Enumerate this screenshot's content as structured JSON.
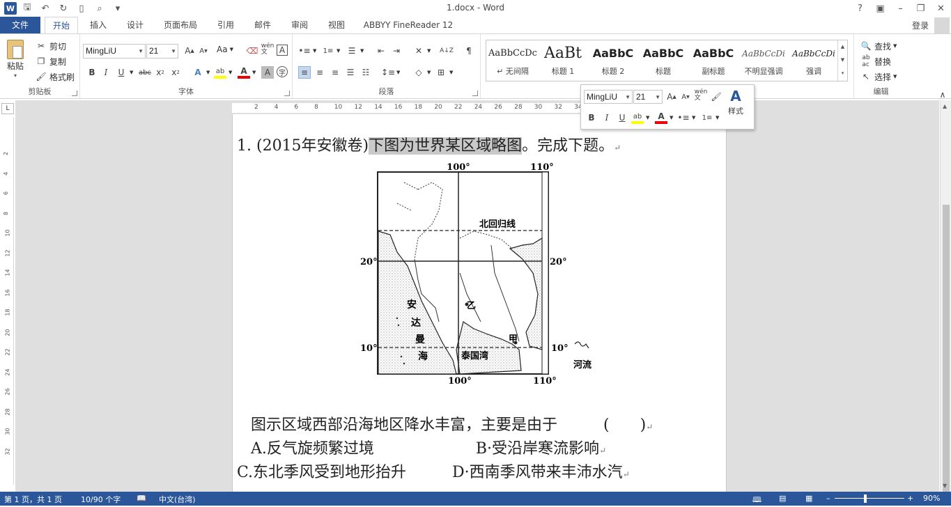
{
  "window": {
    "title": "1.docx - Word",
    "help": "?",
    "login": "登录"
  },
  "tabs": [
    {
      "id": "file",
      "label": "文件"
    },
    {
      "id": "home",
      "label": "开始"
    },
    {
      "id": "insert",
      "label": "插入"
    },
    {
      "id": "design",
      "label": "设计"
    },
    {
      "id": "layout",
      "label": "页面布局"
    },
    {
      "id": "references",
      "label": "引用"
    },
    {
      "id": "mailings",
      "label": "邮件"
    },
    {
      "id": "review",
      "label": "审阅"
    },
    {
      "id": "view",
      "label": "视图"
    },
    {
      "id": "abbyy",
      "label": "ABBYY FineReader 12"
    }
  ],
  "ribbon": {
    "clipboard": {
      "label": "剪贴板",
      "paste": "粘贴",
      "cut": "剪切",
      "copy": "复制",
      "painter": "格式刷"
    },
    "font": {
      "label": "字体",
      "name": "MingLiU",
      "size": "21",
      "aa": "Aa",
      "wen": "wén\n文"
    },
    "paragraph": {
      "label": "段落"
    },
    "styles": {
      "items": [
        {
          "preview": "AaBbCcDc",
          "name": "↵ 无间隔"
        },
        {
          "preview": "AaBt",
          "name": "标题 1"
        },
        {
          "preview": "AaBbC",
          "name": "标题 2"
        },
        {
          "preview": "AaBbC",
          "name": "标题"
        },
        {
          "preview": "AaBbC",
          "name": "副标题"
        },
        {
          "preview": "AaBbCcDi",
          "name": "不明显强调"
        },
        {
          "preview": "AaBbCcDi",
          "name": "强调"
        }
      ]
    },
    "editing": {
      "label": "编辑",
      "find": "查找",
      "replace": "替换",
      "select": "选择"
    }
  },
  "mini_toolbar": {
    "font": "MingLiU",
    "size": "21",
    "styles_label": "样式"
  },
  "ruler": {
    "h_ticks": [
      "2",
      "4",
      "6",
      "8",
      "10",
      "12",
      "14",
      "16",
      "18",
      "20",
      "22",
      "24",
      "26",
      "28",
      "30",
      "32",
      "34"
    ],
    "v_ticks": [
      "2",
      "4",
      "6",
      "8",
      "10",
      "12",
      "14",
      "16",
      "18",
      "20",
      "22",
      "24",
      "26",
      "28",
      "30",
      "32"
    ]
  },
  "document": {
    "q_prefix": "1. (2015年安徽卷)",
    "q_highlight": "下图为世界某区域略图",
    "q_suffix": "。完成下题。",
    "question": "图示区域西部沿海地区降水丰富，主要是由于",
    "paren": "(　　)",
    "optA": "A.反气旋频繁过境",
    "optB": "B·受沿岸寒流影响",
    "optC": "C.东北季风受到地形抬升",
    "optD": "D·西南季风带来丰沛水汽",
    "return_mark": "↵"
  },
  "map": {
    "lon_top_left": "100°",
    "lon_top_right": "110°",
    "lon_bottom_left": "100°",
    "lon_bottom_right": "110°",
    "lat_20_left": "20°",
    "lat_20_right": "20°",
    "lat_10_left": "10°",
    "lat_10_right": "10°",
    "tropic": "北回归线",
    "andaman": [
      "安",
      "达",
      "曼",
      "海"
    ],
    "gulf": "泰国湾",
    "yi": "乙",
    "jia": "甲",
    "legend_river": "河流"
  },
  "status": {
    "page": "第 1 页，共 1 页",
    "words": "10/90 个字",
    "lang": "中文(台湾)",
    "zoom": "90%"
  },
  "colors": {
    "accent": "#2b579a"
  }
}
